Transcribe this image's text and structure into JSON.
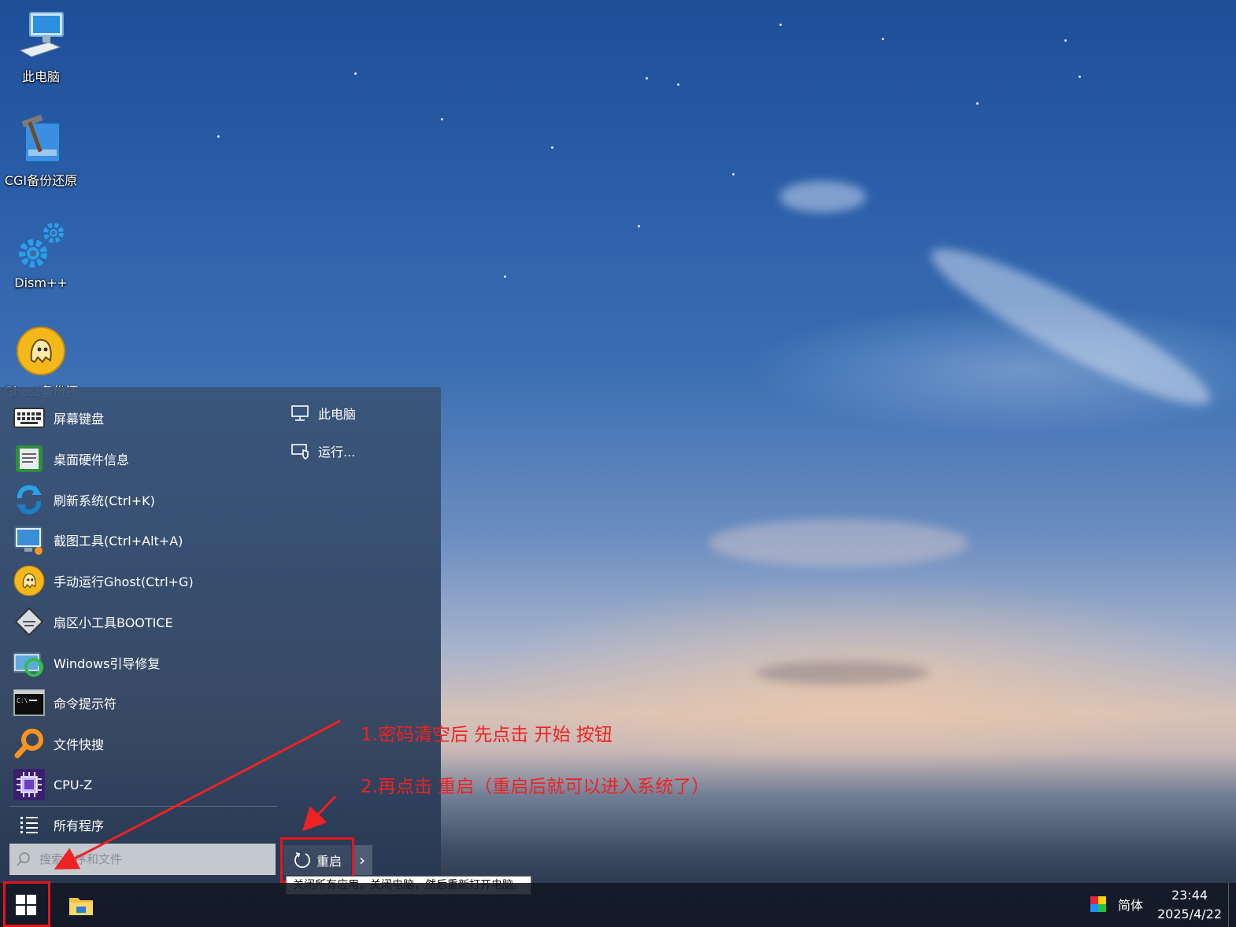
{
  "desktop": {
    "icons": [
      {
        "label": "此电脑",
        "icon": "computer-icon"
      },
      {
        "label": "CGI备份还原",
        "icon": "cgi-backup-icon"
      },
      {
        "label": "Dism++",
        "icon": "gears-icon"
      },
      {
        "label": "Ghost备份还",
        "icon": "ghost-icon"
      }
    ]
  },
  "start_menu": {
    "apps": [
      {
        "label": "屏幕键盘",
        "icon": "keyboard-icon"
      },
      {
        "label": "桌面硬件信息",
        "icon": "hardware-info-icon"
      },
      {
        "label": "刷新系统(Ctrl+K)",
        "icon": "refresh-icon"
      },
      {
        "label": "截图工具(Ctrl+Alt+A)",
        "icon": "screenshot-icon"
      },
      {
        "label": "手动运行Ghost(Ctrl+G)",
        "icon": "ghost-icon"
      },
      {
        "label": "扇区小工具BOOTICE",
        "icon": "bootice-icon"
      },
      {
        "label": "Windows引导修复",
        "icon": "boot-repair-icon"
      },
      {
        "label": "命令提示符",
        "icon": "cmd-icon"
      },
      {
        "label": "文件快搜",
        "icon": "file-search-icon"
      },
      {
        "label": "CPU-Z",
        "icon": "cpu-icon"
      }
    ],
    "all_programs": "所有程序",
    "right_items": [
      {
        "label": "此电脑",
        "icon": "monitor-icon"
      },
      {
        "label": "运行...",
        "icon": "run-icon"
      }
    ],
    "search_placeholder": "搜索程序和文件",
    "power_label": "重启",
    "power_arrow": "›",
    "tooltip": "关闭所有应用，关闭电脑，然后重新打开电脑。"
  },
  "annotations": {
    "step1": "1.密码清空后 先点击 开始 按钮",
    "step2": "2.再点击 重启（重启后就可以进入系统了）",
    "color": "#ee2222"
  },
  "taskbar": {
    "language": "简体",
    "time": "23:44",
    "date": "2025/4/22"
  }
}
